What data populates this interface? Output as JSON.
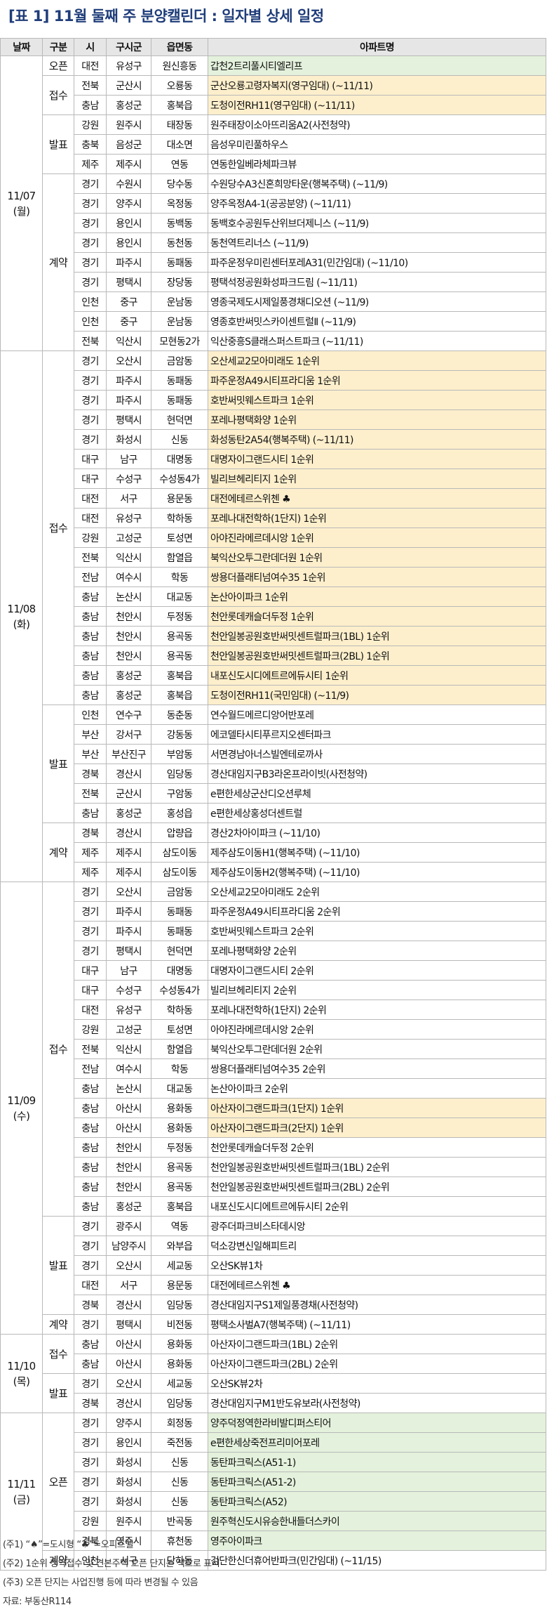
{
  "title": "[표 1] 11월 둘째 주 분양캘린더 : 일자별 상세 일정",
  "headers": [
    "날짜",
    "구분",
    "시",
    "구시군",
    "읍면동",
    "아파트명"
  ],
  "colors": {
    "title": "#1f3d7a",
    "yellow_highlight": "#fdefcc",
    "green_highlight": "#e4f1dc",
    "header_bg": "#e6e6e6"
  },
  "days": [
    {
      "date_line1": "11/07",
      "date_line2": "(월)",
      "groups": [
        {
          "category": "오픈",
          "rows": [
            {
              "si": "대전",
              "gu": "유성구",
              "dong": "원신흥동",
              "apt": "갑천2트리풀시티엘리프",
              "hl": "g"
            }
          ]
        },
        {
          "category": "접수",
          "rows": [
            {
              "si": "전북",
              "gu": "군산시",
              "dong": "오룡동",
              "apt": "군산오룡고령자복지(영구임대)  (~11/11)",
              "hl": "y"
            },
            {
              "si": "충남",
              "gu": "홍성군",
              "dong": "홍북읍",
              "apt": "도청이전RH11(영구임대)  (~11/11)",
              "hl": "y"
            }
          ]
        },
        {
          "category": "발표",
          "rows": [
            {
              "si": "강원",
              "gu": "원주시",
              "dong": "태장동",
              "apt": "원주태장이소아뜨리움A2(사전청약)",
              "hl": ""
            },
            {
              "si": "충북",
              "gu": "음성군",
              "dong": "대소면",
              "apt": "음성우미린풀하우스",
              "hl": ""
            },
            {
              "si": "제주",
              "gu": "제주시",
              "dong": "연동",
              "apt": "연동한일베라체파크뷰",
              "hl": ""
            }
          ]
        },
        {
          "category": "계약",
          "rows": [
            {
              "si": "경기",
              "gu": "수원시",
              "dong": "당수동",
              "apt": "수원당수A3신혼희망타운(행복주택)  (~11/9)",
              "hl": ""
            },
            {
              "si": "경기",
              "gu": "양주시",
              "dong": "옥정동",
              "apt": "양주옥정A4-1(공공분양)  (~11/11)",
              "hl": ""
            },
            {
              "si": "경기",
              "gu": "용인시",
              "dong": "동백동",
              "apt": "동백호수공원두산위브더제니스  (~11/9)",
              "hl": ""
            },
            {
              "si": "경기",
              "gu": "용인시",
              "dong": "동천동",
              "apt": "동천역트리너스  (~11/9)",
              "hl": ""
            },
            {
              "si": "경기",
              "gu": "파주시",
              "dong": "동패동",
              "apt": "파주운정우미린센터포레A31(민간임대)  (~11/10)",
              "hl": ""
            },
            {
              "si": "경기",
              "gu": "평택시",
              "dong": "장당동",
              "apt": "평택석정공원화성파크드림  (~11/11)",
              "hl": ""
            },
            {
              "si": "인천",
              "gu": "중구",
              "dong": "운남동",
              "apt": "영종국제도시제일풍경채디오션  (~11/9)",
              "hl": ""
            },
            {
              "si": "인천",
              "gu": "중구",
              "dong": "운남동",
              "apt": "영종호반써밋스카이센트럴Ⅱ  (~11/9)",
              "hl": ""
            },
            {
              "si": "전북",
              "gu": "익산시",
              "dong": "모현동2가",
              "apt": "익산중흥S클래스퍼스트파크  (~11/11)",
              "hl": ""
            }
          ]
        }
      ]
    },
    {
      "date_line1": "11/08",
      "date_line2": "(화)",
      "groups": [
        {
          "category": "접수",
          "rows": [
            {
              "si": "경기",
              "gu": "오산시",
              "dong": "금암동",
              "apt": "오산세교2모아미래도 1순위",
              "hl": "y"
            },
            {
              "si": "경기",
              "gu": "파주시",
              "dong": "동패동",
              "apt": "파주운정A49시티프라디움 1순위",
              "hl": "y"
            },
            {
              "si": "경기",
              "gu": "파주시",
              "dong": "동패동",
              "apt": "호반써밋웨스트파크 1순위",
              "hl": "y"
            },
            {
              "si": "경기",
              "gu": "평택시",
              "dong": "현덕면",
              "apt": "포레나평택화양 1순위",
              "hl": "y"
            },
            {
              "si": "경기",
              "gu": "화성시",
              "dong": "신동",
              "apt": "화성동탄2A54(행복주택)  (~11/11)",
              "hl": "y"
            },
            {
              "si": "대구",
              "gu": "남구",
              "dong": "대명동",
              "apt": "대명자이그랜드시티 1순위",
              "hl": "y"
            },
            {
              "si": "대구",
              "gu": "수성구",
              "dong": "수성동4가",
              "apt": "빌리브헤리티지 1순위",
              "hl": "y"
            },
            {
              "si": "대전",
              "gu": "서구",
              "dong": "용문동",
              "apt": "대전에테르스위첸 ♣",
              "hl": "y"
            },
            {
              "si": "대전",
              "gu": "유성구",
              "dong": "학하동",
              "apt": "포레나대전학하(1단지) 1순위",
              "hl": "y"
            },
            {
              "si": "강원",
              "gu": "고성군",
              "dong": "토성면",
              "apt": "아야진라메르데시앙 1순위",
              "hl": "y"
            },
            {
              "si": "전북",
              "gu": "익산시",
              "dong": "함열읍",
              "apt": "북익산오투그란데더원 1순위",
              "hl": "y"
            },
            {
              "si": "전남",
              "gu": "여수시",
              "dong": "학동",
              "apt": "쌍용더플래티넘여수35 1순위",
              "hl": "y"
            },
            {
              "si": "충남",
              "gu": "논산시",
              "dong": "대교동",
              "apt": "논산아이파크 1순위",
              "hl": "y"
            },
            {
              "si": "충남",
              "gu": "천안시",
              "dong": "두정동",
              "apt": "천안롯데캐슬더두정 1순위",
              "hl": "y"
            },
            {
              "si": "충남",
              "gu": "천안시",
              "dong": "용곡동",
              "apt": "천안일봉공원호반써밋센트럴파크(1BL) 1순위",
              "hl": "y"
            },
            {
              "si": "충남",
              "gu": "천안시",
              "dong": "용곡동",
              "apt": "천안일봉공원호반써밋센트럴파크(2BL) 1순위",
              "hl": "y"
            },
            {
              "si": "충남",
              "gu": "홍성군",
              "dong": "홍북읍",
              "apt": "내포신도시디에트르에듀시티 1순위",
              "hl": "y"
            },
            {
              "si": "충남",
              "gu": "홍성군",
              "dong": "홍북읍",
              "apt": "도청이전RH11(국민임대)  (~11/9)",
              "hl": "y"
            }
          ]
        },
        {
          "category": "발표",
          "rows": [
            {
              "si": "인천",
              "gu": "연수구",
              "dong": "동춘동",
              "apt": "연수월드메르디앙어반포레",
              "hl": ""
            },
            {
              "si": "부산",
              "gu": "강서구",
              "dong": "강동동",
              "apt": "에코델타시티푸르지오센터파크",
              "hl": ""
            },
            {
              "si": "부산",
              "gu": "부산진구",
              "dong": "부암동",
              "apt": "서면경남아너스빌엔테로까사",
              "hl": ""
            },
            {
              "si": "경북",
              "gu": "경산시",
              "dong": "임당동",
              "apt": "경산대임지구B3라온프라이빗(사전청약)",
              "hl": ""
            },
            {
              "si": "전북",
              "gu": "군산시",
              "dong": "구암동",
              "apt": "e편한세상군산디오션루체",
              "hl": ""
            },
            {
              "si": "충남",
              "gu": "홍성군",
              "dong": "홍성읍",
              "apt": "e편한세상홍성더센트럴",
              "hl": ""
            }
          ]
        },
        {
          "category": "계약",
          "rows": [
            {
              "si": "경북",
              "gu": "경산시",
              "dong": "압량읍",
              "apt": "경산2차아이파크  (~11/10)",
              "hl": ""
            },
            {
              "si": "제주",
              "gu": "제주시",
              "dong": "삼도이동",
              "apt": "제주삼도이동H1(행복주택)  (~11/10)",
              "hl": ""
            },
            {
              "si": "제주",
              "gu": "제주시",
              "dong": "삼도이동",
              "apt": "제주삼도이동H2(행복주택)  (~11/10)",
              "hl": ""
            }
          ]
        }
      ]
    },
    {
      "date_line1": "11/09",
      "date_line2": "(수)",
      "groups": [
        {
          "category": "접수",
          "rows": [
            {
              "si": "경기",
              "gu": "오산시",
              "dong": "금암동",
              "apt": "오산세교2모아미래도 2순위",
              "hl": ""
            },
            {
              "si": "경기",
              "gu": "파주시",
              "dong": "동패동",
              "apt": "파주운정A49시티프라디움 2순위",
              "hl": ""
            },
            {
              "si": "경기",
              "gu": "파주시",
              "dong": "동패동",
              "apt": "호반써밋웨스트파크 2순위",
              "hl": ""
            },
            {
              "si": "경기",
              "gu": "평택시",
              "dong": "현덕면",
              "apt": "포레나평택화양 2순위",
              "hl": ""
            },
            {
              "si": "대구",
              "gu": "남구",
              "dong": "대명동",
              "apt": "대명자이그랜드시티 2순위",
              "hl": ""
            },
            {
              "si": "대구",
              "gu": "수성구",
              "dong": "수성동4가",
              "apt": "빌리브헤리티지 2순위",
              "hl": ""
            },
            {
              "si": "대전",
              "gu": "유성구",
              "dong": "학하동",
              "apt": "포레나대전학하(1단지) 2순위",
              "hl": ""
            },
            {
              "si": "강원",
              "gu": "고성군",
              "dong": "토성면",
              "apt": "아야진라메르데시앙 2순위",
              "hl": ""
            },
            {
              "si": "전북",
              "gu": "익산시",
              "dong": "함열읍",
              "apt": "북익산오투그란데더원 2순위",
              "hl": ""
            },
            {
              "si": "전남",
              "gu": "여수시",
              "dong": "학동",
              "apt": "쌍용더플래티넘여수35 2순위",
              "hl": ""
            },
            {
              "si": "충남",
              "gu": "논산시",
              "dong": "대교동",
              "apt": "논산아이파크 2순위",
              "hl": ""
            },
            {
              "si": "충남",
              "gu": "아산시",
              "dong": "용화동",
              "apt": "아산자이그랜드파크(1단지) 1순위",
              "hl": "y"
            },
            {
              "si": "충남",
              "gu": "아산시",
              "dong": "용화동",
              "apt": "아산자이그랜드파크(2단지) 1순위",
              "hl": "y"
            },
            {
              "si": "충남",
              "gu": "천안시",
              "dong": "두정동",
              "apt": "천안롯데캐슬더두정 2순위",
              "hl": ""
            },
            {
              "si": "충남",
              "gu": "천안시",
              "dong": "용곡동",
              "apt": "천안일봉공원호반써밋센트럴파크(1BL) 2순위",
              "hl": ""
            },
            {
              "si": "충남",
              "gu": "천안시",
              "dong": "용곡동",
              "apt": "천안일봉공원호반써밋센트럴파크(2BL) 2순위",
              "hl": ""
            },
            {
              "si": "충남",
              "gu": "홍성군",
              "dong": "홍북읍",
              "apt": "내포신도시디에트르에듀시티 2순위",
              "hl": ""
            }
          ]
        },
        {
          "category": "발표",
          "rows": [
            {
              "si": "경기",
              "gu": "광주시",
              "dong": "역동",
              "apt": "광주더파크비스타데시앙",
              "hl": ""
            },
            {
              "si": "경기",
              "gu": "남양주시",
              "dong": "와부읍",
              "apt": "덕소강변신일해피트리",
              "hl": ""
            },
            {
              "si": "경기",
              "gu": "오산시",
              "dong": "세교동",
              "apt": "오산SK뷰1차",
              "hl": ""
            },
            {
              "si": "대전",
              "gu": "서구",
              "dong": "용문동",
              "apt": "대전에테르스위첸 ♣",
              "hl": ""
            },
            {
              "si": "경북",
              "gu": "경산시",
              "dong": "임당동",
              "apt": "경산대임지구S1제일풍경채(사전청약)",
              "hl": ""
            }
          ]
        },
        {
          "category": "계약",
          "rows": [
            {
              "si": "경기",
              "gu": "평택시",
              "dong": "비전동",
              "apt": "평택소사벌A7(행복주택)  (~11/11)",
              "hl": ""
            }
          ]
        }
      ]
    },
    {
      "date_line1": "11/10",
      "date_line2": "(목)",
      "groups": [
        {
          "category": "접수",
          "rows": [
            {
              "si": "충남",
              "gu": "아산시",
              "dong": "용화동",
              "apt": "아산자이그랜드파크(1BL) 2순위",
              "hl": ""
            },
            {
              "si": "충남",
              "gu": "아산시",
              "dong": "용화동",
              "apt": "아산자이그랜드파크(2BL) 2순위",
              "hl": ""
            }
          ]
        },
        {
          "category": "발표",
          "rows": [
            {
              "si": "경기",
              "gu": "오산시",
              "dong": "세교동",
              "apt": "오산SK뷰2차",
              "hl": ""
            },
            {
              "si": "경북",
              "gu": "경산시",
              "dong": "임당동",
              "apt": "경산대임지구M1반도유보라(사전청약)",
              "hl": ""
            }
          ]
        }
      ]
    },
    {
      "date_line1": "11/11",
      "date_line2": "(금)",
      "groups": [
        {
          "category": "오픈",
          "rows": [
            {
              "si": "경기",
              "gu": "양주시",
              "dong": "회정동",
              "apt": "양주덕정역한라비발디퍼스티어",
              "hl": "g"
            },
            {
              "si": "경기",
              "gu": "용인시",
              "dong": "죽전동",
              "apt": "e편한세상죽전프리미어포레",
              "hl": "g"
            },
            {
              "si": "경기",
              "gu": "화성시",
              "dong": "신동",
              "apt": "동탄파크릭스(A51-1)",
              "hl": "g"
            },
            {
              "si": "경기",
              "gu": "화성시",
              "dong": "신동",
              "apt": "동탄파크릭스(A51-2)",
              "hl": "g"
            },
            {
              "si": "경기",
              "gu": "화성시",
              "dong": "신동",
              "apt": "동탄파크릭스(A52)",
              "hl": "g"
            },
            {
              "si": "강원",
              "gu": "원주시",
              "dong": "반곡동",
              "apt": "원주혁신도시유승한내들더스카이",
              "hl": "g"
            },
            {
              "si": "경북",
              "gu": "영주시",
              "dong": "휴천동",
              "apt": "영주아이파크",
              "hl": "g"
            }
          ]
        },
        {
          "category": "계약",
          "rows": [
            {
              "si": "인천",
              "gu": "서구",
              "dong": "당하동",
              "apt": "검단한신더휴어반파크(민간임대)  (~11/15)",
              "hl": ""
            }
          ]
        }
      ]
    }
  ],
  "notes": [
    "(주1) “♠”=도시형 “♣”=오피스텔",
    "(주2) 1순위 청약접수 및 견본주택 오픈 단지는 색으로  표시",
    "(주3) 오픈 단지는 사업진행 등에 따라 변경될 수 있음",
    "자료: 부동산R114"
  ]
}
